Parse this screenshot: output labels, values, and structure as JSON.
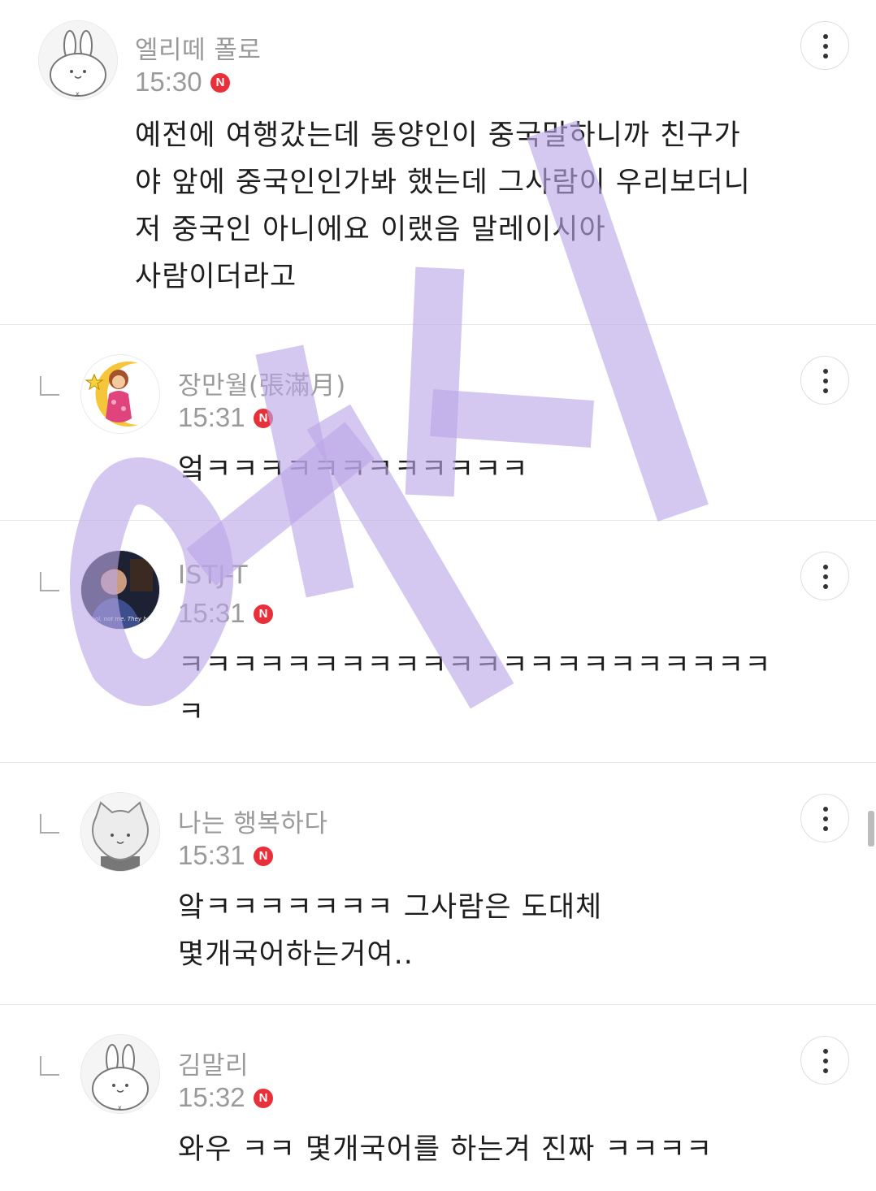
{
  "comments": [
    {
      "nickname": "엘리떼 폴로",
      "time": "15:30",
      "badge": "N",
      "lines": [
        "예전에 여행갔는데 동양인이 중국말하니까 친구가",
        "야 앞에 중국인인가봐 했는데 그사람이 우리보더니",
        "저 중국인 아니에요 이랬음 말레이시아",
        "사람이더라고"
      ]
    },
    {
      "nickname": "장만월(張滿月)",
      "time": "15:31",
      "badge": "N",
      "lines": [
        "엌ㅋㅋㅋㅋㅋㅋㅋㅋㅋㅋㅋㅋ"
      ]
    },
    {
      "nickname": "ISTJ-T",
      "time": "15:31",
      "badge": "N",
      "avatar_caption": "...ool, not me. They h...",
      "lines": [
        "ㅋㅋㅋㅋㅋㅋㅋㅋㅋㅋㅋㅋㅋㅋㅋㅋㅋㅋㅋㅋㅋㅋ",
        "ㅋ"
      ]
    },
    {
      "nickname": "나는 행복하다",
      "time": "15:31",
      "badge": "N",
      "lines": [
        "앜ㅋㅋㅋㅋㅋㅋㅋ 그사람은 도대체",
        "몇개국어하는거여.."
      ]
    },
    {
      "nickname": "김말리",
      "time": "15:32",
      "badge": "N",
      "lines": [
        "와우 ㅋㅋ 몇개국어를 하는겨 진짜 ㅋㅋㅋㅋ"
      ]
    }
  ],
  "icons": {
    "more": "more-vertical-icon",
    "reply": "reply-indent-icon",
    "new_badge": "new-badge-icon"
  },
  "colors": {
    "badge": "#e8303a",
    "meta_text": "#9a9a9a",
    "watermark": "#b9a6e6"
  },
  "watermark_text": "여시"
}
